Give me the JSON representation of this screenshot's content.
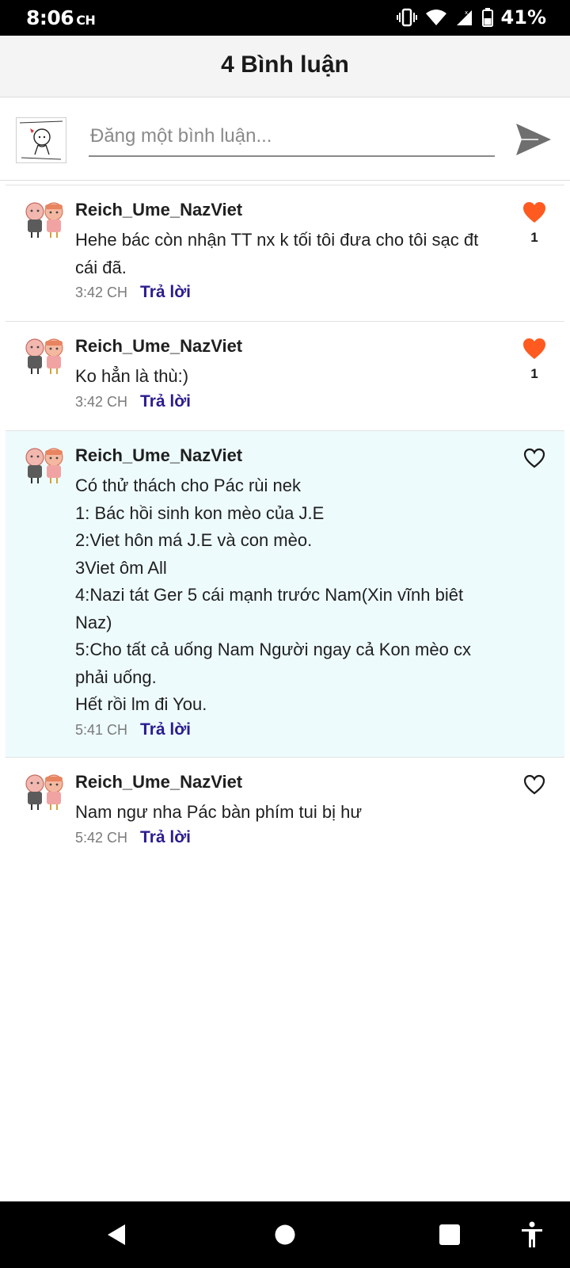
{
  "status_bar": {
    "time": "8:06",
    "time_suffix": "CH",
    "battery": "41%",
    "icons": [
      "vibrate-icon",
      "wifi-icon",
      "signal-icon",
      "battery-icon"
    ]
  },
  "header": {
    "title": "4 Bình luận"
  },
  "composer": {
    "placeholder": "Đăng một bình luận...",
    "value": ""
  },
  "comments": [
    {
      "user": "Reich_Ume_NazViet",
      "lines": [
        "Hehe bác còn nhận TT nx k tối tôi đưa cho tôi sạc đt",
        "cái đã."
      ],
      "time": "3:42 CH",
      "reply": "Trả lời",
      "liked": true,
      "likes": "1",
      "highlighted": false
    },
    {
      "user": "Reich_Ume_NazViet",
      "lines": [
        "Ko hẳn là thù:)"
      ],
      "time": "3:42 CH",
      "reply": "Trả lời",
      "liked": true,
      "likes": "1",
      "highlighted": false
    },
    {
      "user": "Reich_Ume_NazViet",
      "lines": [
        "Có thử thách cho Pác rùi nek",
        "1: Bác hồi sinh kon mèo của J.E",
        "2:Viet hôn má J.E và con mèo.",
        "3Viet ôm All",
        "4:Nazi tát Ger 5 cái mạnh trước Nam(Xin vĩnh biêt",
        "Naz)",
        "5:Cho tất cả uống Nam Người ngay cả Kon mèo cx",
        "phải uống.",
        "Hết rồi lm đi You."
      ],
      "time": "5:41 CH",
      "reply": "Trả lời",
      "liked": false,
      "likes": "",
      "highlighted": true
    },
    {
      "user": "Reich_Ume_NazViet",
      "lines": [
        "Nam ngư nha Pác bàn phím tui bị hư"
      ],
      "time": "5:42 CH",
      "reply": "Trả lời",
      "liked": false,
      "likes": "",
      "highlighted": false
    }
  ],
  "colors": {
    "accent_like": "#ff5a1f",
    "reply_link": "#2a1c8f",
    "highlight_bg": "#eefbfd",
    "header_bg": "#f4f4f4"
  },
  "nav_bar": {
    "icons": [
      "back-icon",
      "home-icon",
      "recents-icon",
      "accessibility-icon"
    ]
  }
}
